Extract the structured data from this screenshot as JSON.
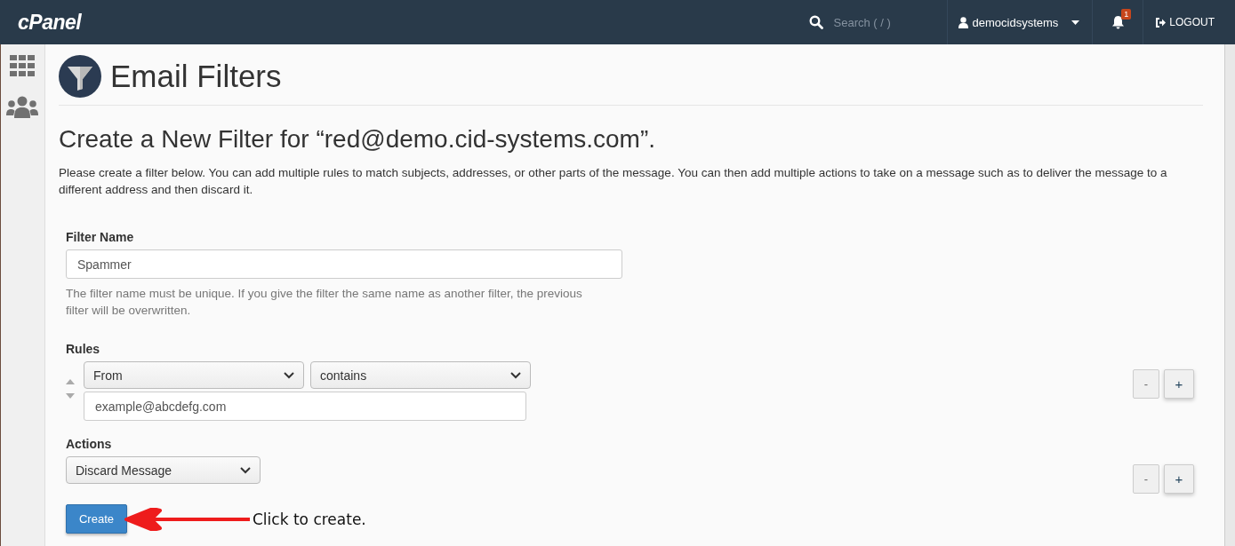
{
  "header": {
    "logo": "cPanel",
    "search": {
      "placeholder": "Search ( / )"
    },
    "user": "democidsystems",
    "notifications": {
      "count": "1"
    },
    "logout": "LOGOUT"
  },
  "page": {
    "title": "Email Filters"
  },
  "heading": "Create a New Filter for “red@demo.cid-systems.com”.",
  "intro": "Please create a filter below. You can add multiple rules to match subjects, addresses, or other parts of the message. You can then add multiple actions to take on a message such as to deliver the message to a different address and then discard it.",
  "filter_name": {
    "label": "Filter Name",
    "value": "Spammer",
    "help": "The filter name must be unique. If you give the filter the same name as another filter, the previous filter will be overwritten."
  },
  "rules": {
    "label": "Rules",
    "items": [
      {
        "field": "From",
        "operator": "contains",
        "value": "example@abcdefg.com"
      }
    ],
    "remove": "-",
    "add": "+"
  },
  "actions": {
    "label": "Actions",
    "items": [
      {
        "action": "Discard Message"
      }
    ],
    "remove": "-",
    "add": "+"
  },
  "create_button": "Create",
  "annotation": "Click to create."
}
